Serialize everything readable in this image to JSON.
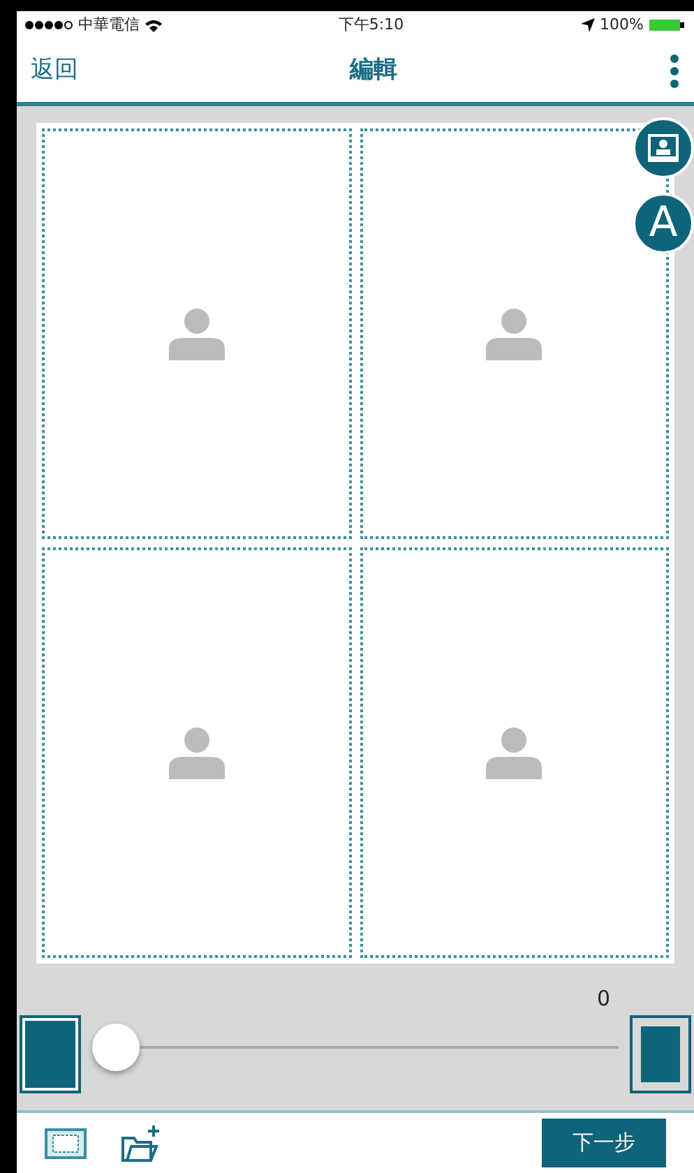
{
  "status_bar": {
    "carrier": "中華電信",
    "time": "下午5:10",
    "battery": "100%"
  },
  "nav": {
    "back": "返回",
    "title": "編輯"
  },
  "side_tools": [
    {
      "kind": "photo"
    },
    {
      "kind": "text",
      "label": "A"
    }
  ],
  "slider": {
    "level": 0,
    "reading": "0"
  },
  "next_button": "下一步"
}
